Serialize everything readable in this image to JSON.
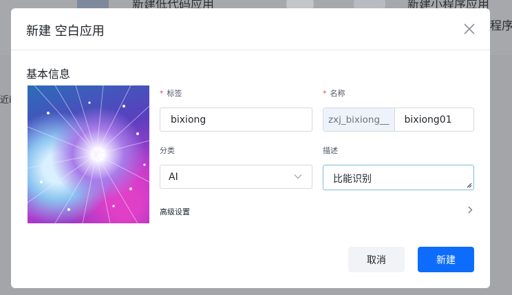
{
  "background": {
    "card1_title": "新建低代码应用",
    "card2_title": "新建小程序应用",
    "right_text": "程序",
    "left_text": "近i"
  },
  "modal": {
    "title": "新建 空白应用",
    "section_title": "基本信息",
    "fields": {
      "tag": {
        "label": "标签",
        "value": "bixiong"
      },
      "name": {
        "label": "名称",
        "prefix": "zxj_bixiong__",
        "value": "bixiong01"
      },
      "category": {
        "label": "分类",
        "value": "AI"
      },
      "description": {
        "label": "描述",
        "value": "比能识别"
      }
    },
    "advanced_label": "高级设置",
    "cancel_label": "取消",
    "create_label": "新建"
  },
  "colors": {
    "primary": "#0d6cfb",
    "required": "#e34d59",
    "focus_border": "#7dbcd8"
  }
}
